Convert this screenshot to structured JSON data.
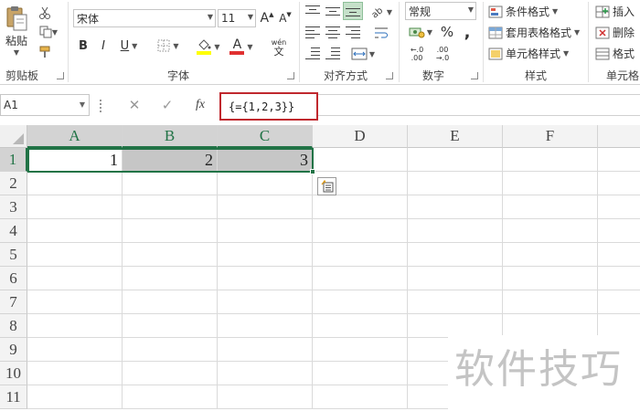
{
  "ribbon": {
    "clipboard": {
      "paste_label": "粘贴",
      "group_label": "剪贴板"
    },
    "font": {
      "font_name": "宋体",
      "font_size": "11",
      "bold": "B",
      "italic": "I",
      "underline": "U",
      "phonetic_top": "wén",
      "phonetic_bottom": "文",
      "grow": "A",
      "shrink": "A",
      "font_color_letter": "A",
      "group_label": "字体"
    },
    "alignment": {
      "group_label": "对齐方式"
    },
    "number": {
      "format": "常规",
      "percent": "%",
      "comma": ",",
      "inc_decimal": "←.0\n.00",
      "inc_decimal_a": "←.0",
      "inc_decimal_b": ".00",
      "dec_decimal_a": ".00",
      "dec_decimal_b": "→.0",
      "group_label": "数字"
    },
    "styles": {
      "conditional": "条件格式",
      "table": "套用表格格式",
      "cell": "单元格样式",
      "group_label": "样式"
    },
    "cells": {
      "insert": "插入",
      "delete": "删除",
      "format": "格式",
      "group_label": "单元格"
    },
    "colors": {
      "highlight": "#ffff00",
      "font_color": "#e03030",
      "accent": "#217346"
    }
  },
  "formula_bar": {
    "name_box": "A1",
    "cancel": "✕",
    "enter": "✓",
    "fx": "fx",
    "formula": "{={1,2,3}}"
  },
  "sheet": {
    "columns": [
      "A",
      "B",
      "C",
      "D",
      "E",
      "F"
    ],
    "rows": [
      "1",
      "2",
      "3",
      "4",
      "5",
      "6",
      "7",
      "8",
      "9",
      "10",
      "11"
    ],
    "row1_values": [
      "1",
      "2",
      "3"
    ],
    "selection_color": "#217346",
    "highlight_color": "#c6c6c6"
  },
  "watermark": "软件技巧"
}
